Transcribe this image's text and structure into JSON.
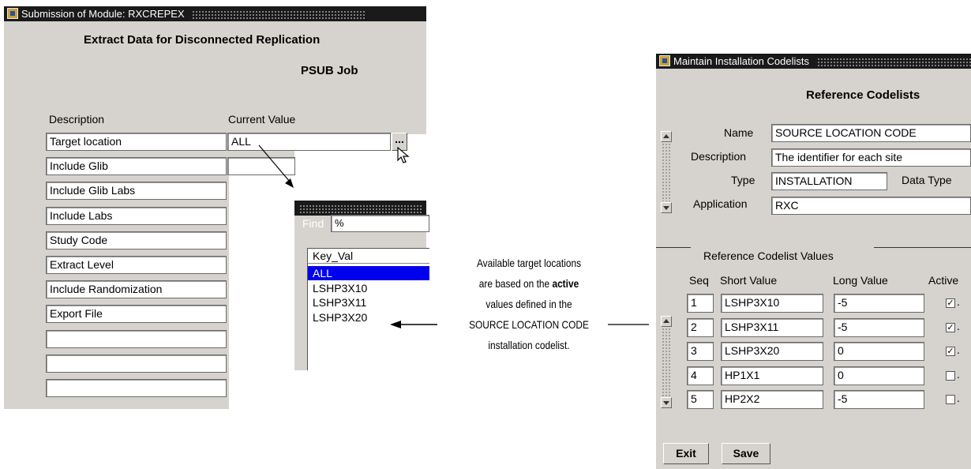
{
  "submission_window": {
    "title": "Submission of Module: RXCREPEX",
    "heading": "Extract Data for Disconnected Replication",
    "subheading": "PSUB Job",
    "col_description": "Description",
    "col_current_value": "Current Value",
    "rows": [
      "Target location",
      "Include Glib",
      "Include Glib Labs",
      "Include Labs",
      "Study Code",
      "Extract Level",
      "Include Randomization",
      "Export File",
      "",
      "",
      ""
    ],
    "current_value": "ALL",
    "lov_button": "..."
  },
  "lov_popup": {
    "find_label": "Find",
    "find_value": "%",
    "column_header": "Key_Val",
    "items": [
      "ALL",
      "LSHP3X10",
      "LSHP3X11",
      "LSHP3X20"
    ],
    "selected_index": 0
  },
  "annotation": {
    "line1": "Available target locations",
    "line2_prefix": "are based on the ",
    "line2_bold": "active",
    "line3": "values defined in the",
    "line4": "SOURCE LOCATION CODE",
    "line5": "installation codelist."
  },
  "codelist_window": {
    "title": "Maintain Installation Codelists",
    "heading": "Reference Codelists",
    "name_label": "Name",
    "name_value": "SOURCE LOCATION CODE",
    "description_label": "Description",
    "description_value": "The identifier for each site",
    "type_label": "Type",
    "type_value": "INSTALLATION",
    "data_type_label": "Data Type",
    "application_label": "Application",
    "application_value": "RXC",
    "values_section_label": "Reference Codelist Values",
    "col_seq": "Seq",
    "col_short": "Short Value",
    "col_long": "Long Value",
    "col_active": "Active",
    "rows": [
      {
        "seq": "1",
        "short": "LSHP3X10",
        "long": "-5",
        "active": true
      },
      {
        "seq": "2",
        "short": "LSHP3X11",
        "long": "-5",
        "active": true
      },
      {
        "seq": "3",
        "short": "LSHP3X20",
        "long": "0",
        "active": true
      },
      {
        "seq": "4",
        "short": "HP1X1",
        "long": "0",
        "active": false
      },
      {
        "seq": "5",
        "short": "HP2X2",
        "long": "-5",
        "active": false
      }
    ],
    "exit_button": "Exit",
    "save_button": "Save"
  },
  "colors": {
    "window_bg": "#d6d3ce",
    "titlebar_bg": "#1a1a1a",
    "selection_bg": "#0000ee"
  },
  "icons": [
    "window-app-icon",
    "lov-ellipsis-icon",
    "mouse-pointer-icon",
    "arrow-icon",
    "scroll-up-icon",
    "scroll-down-icon",
    "checkbox-checked-icon",
    "checkbox-unchecked-icon"
  ]
}
